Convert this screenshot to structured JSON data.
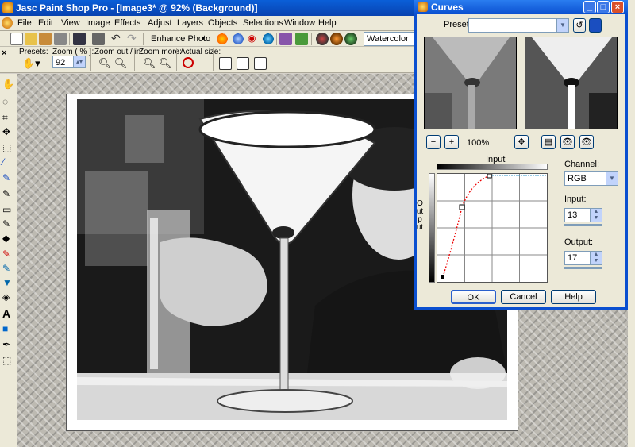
{
  "app": {
    "title": "Jasc Paint Shop Pro - [Image3* @  92% (Background)]"
  },
  "menu": [
    "File",
    "Edit",
    "View",
    "Image",
    "Effects",
    "Adjust",
    "Layers",
    "Objects",
    "Selections",
    "Window",
    "Help"
  ],
  "toolbar": {
    "enhance_photo": "Enhance Photo",
    "watercolor": "Watercolor"
  },
  "tool_options": {
    "presets_label": "Presets:",
    "zoom_label": "Zoom ( % ):",
    "zoom_value": "92",
    "zoom_in_out_label": "Zoom out / in:",
    "zoom_more_label": "Zoom more:",
    "actual_size_label": "Actual size:"
  },
  "curves_dialog": {
    "title": "Curves",
    "presets_label": "Presets:",
    "presets_value": "",
    "zoom_percent": "100%",
    "input_bar_label": "Input",
    "output_axis_label": "Output",
    "channel_label": "Channel:",
    "channel_value": "RGB",
    "input_label": "Input:",
    "input_value": "13",
    "output_label": "Output:",
    "output_value": "17",
    "ok_label": "OK",
    "cancel_label": "Cancel",
    "help_label": "Help"
  },
  "icons": {
    "zoom_out": "magnifier-minus-icon",
    "zoom_in": "magnifier-plus-icon",
    "pan": "pan-hand-icon"
  }
}
